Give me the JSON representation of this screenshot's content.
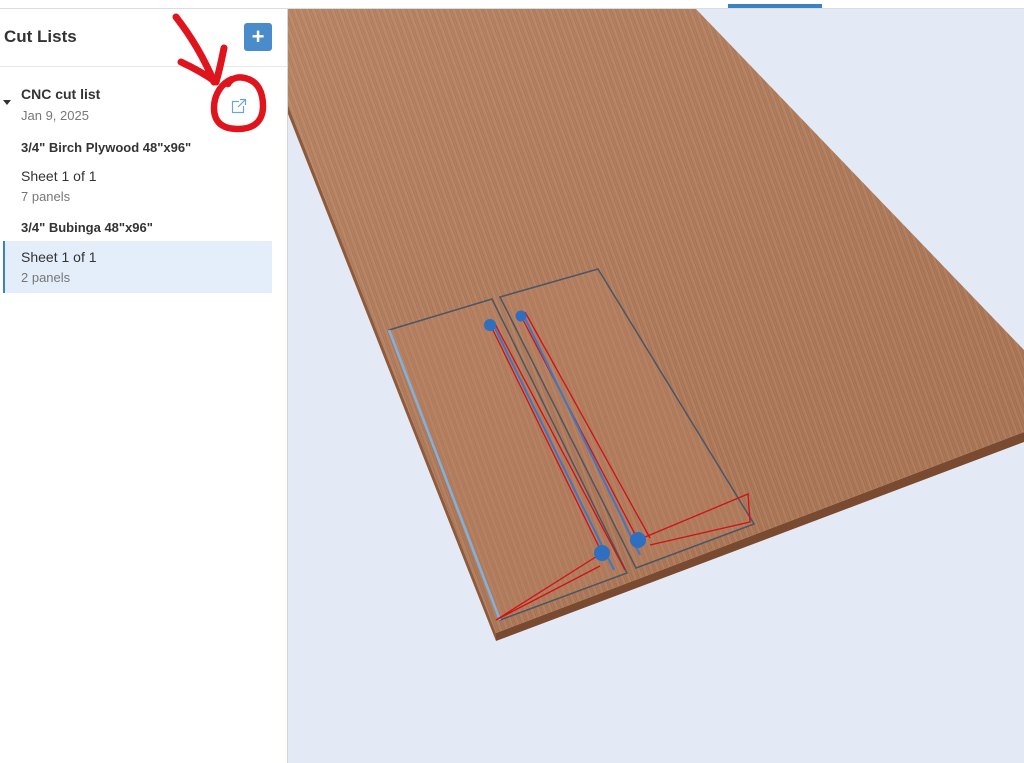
{
  "sidebar": {
    "title": "Cut Lists",
    "add_button_label": "+",
    "cut_list": {
      "name": "CNC cut list",
      "date": "Jan 9, 2025"
    },
    "materials": [
      {
        "title": "3/4\" Birch Plywood 48\"x96\"",
        "sheets": [
          {
            "name": "Sheet 1 of 1",
            "panels": "7 panels",
            "selected": false
          }
        ]
      },
      {
        "title": "3/4\" Bubinga 48\"x96\"",
        "sheets": [
          {
            "name": "Sheet 1 of 1",
            "panels": "2 panels",
            "selected": true
          }
        ]
      }
    ]
  },
  "colors": {
    "accent": "#4a8ccb",
    "selected_bg": "#e4eefa",
    "annotation": "#e0141c",
    "wood": "#b07a58",
    "viewport_bg": "#e4eaf5"
  },
  "icons": {
    "add": "plus-icon",
    "open": "external-link-icon",
    "expand": "caret-down-icon"
  }
}
